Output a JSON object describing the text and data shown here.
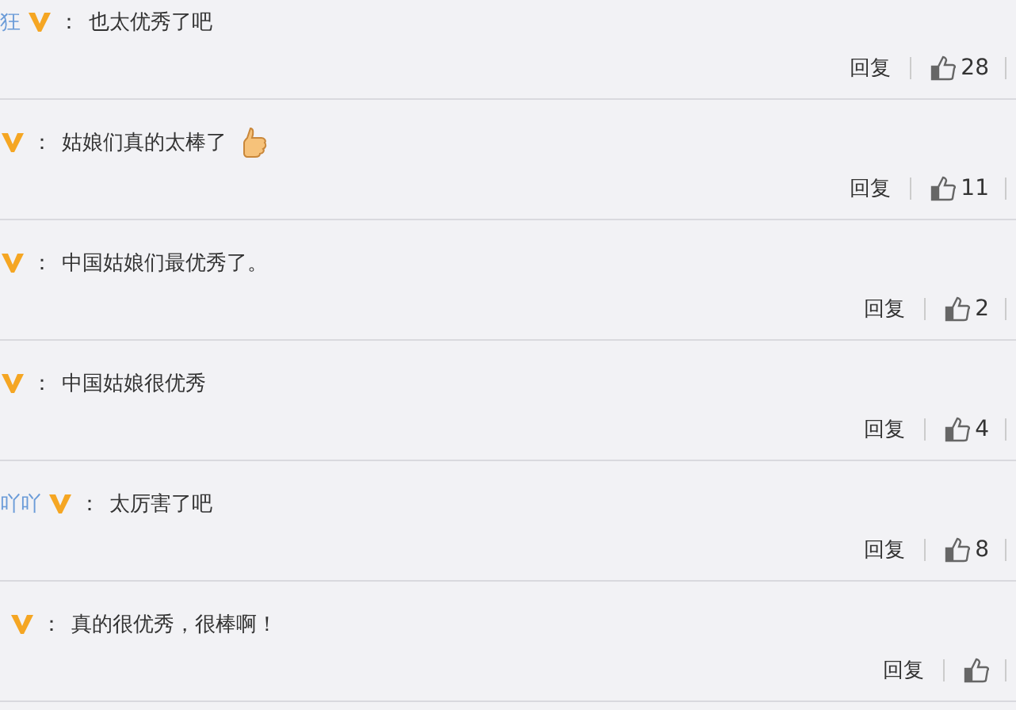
{
  "comments": [
    {
      "user": "狂",
      "colon": "：",
      "text": "也太优秀了吧",
      "emoji": false,
      "reply": "回复",
      "likes": "28"
    },
    {
      "colon": "：",
      "text": "姑娘们真的太棒了",
      "emoji": true,
      "reply": "回复",
      "likes": "11"
    },
    {
      "colon": "：",
      "text": "中国姑娘们最优秀了。",
      "emoji": false,
      "reply": "回复",
      "likes": "2"
    },
    {
      "colon": "：",
      "text": "中国姑娘很优秀",
      "emoji": false,
      "reply": "回复",
      "likes": "4"
    },
    {
      "user": "吖吖",
      "colon": "：",
      "text": "太厉害了吧",
      "emoji": false,
      "reply": "回复",
      "likes": "8"
    },
    {
      "colon": "：",
      "text": "真的很优秀，很棒啊！",
      "emoji": false,
      "reply": "回复"
    }
  ]
}
